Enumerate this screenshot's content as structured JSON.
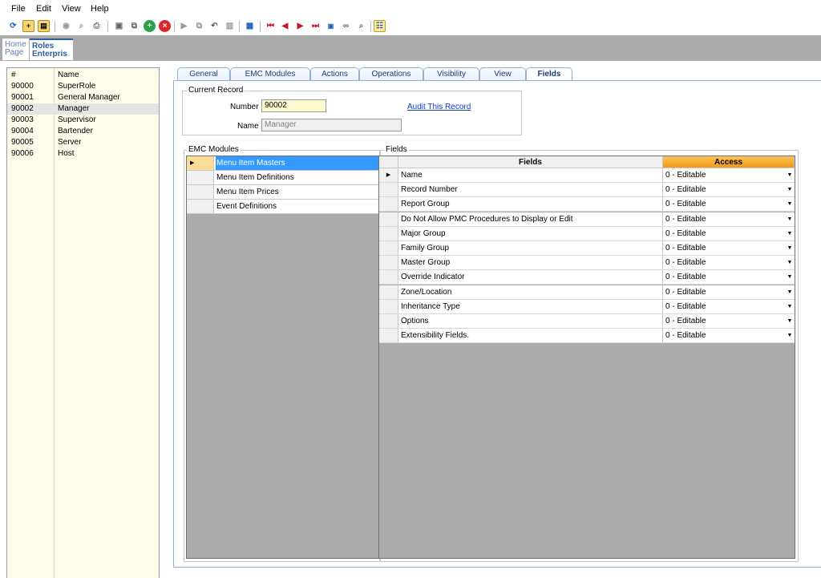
{
  "menu": [
    "File",
    "Edit",
    "View",
    "Help"
  ],
  "toolbar_icons": [
    "refresh-icon",
    "new-folder-icon",
    "open-folder-icon",
    "circle-icon",
    "search-doc-icon",
    "print-icon",
    "save-icon",
    "copy-icon",
    "add-icon",
    "delete-icon",
    "split-icon",
    "duplicate-icon",
    "undo-icon",
    "paste-icon",
    "export-icon",
    "first-record-icon",
    "previous-record-icon",
    "next-record-icon",
    "last-record-icon",
    "goto-record-icon",
    "binoculars-icon",
    "find-icon",
    "table-view-icon"
  ],
  "page_tabs": [
    {
      "line1": "Home",
      "line2": "Page"
    },
    {
      "line1": "Roles",
      "line2": "Enterpris"
    }
  ],
  "left_list": {
    "headers": [
      "#",
      "Name"
    ],
    "rows": [
      {
        "id": "90000",
        "name": "SuperRole"
      },
      {
        "id": "90001",
        "name": "General Manager"
      },
      {
        "id": "90002",
        "name": "Manager"
      },
      {
        "id": "90003",
        "name": "Supervisor"
      },
      {
        "id": "90004",
        "name": "Bartender"
      },
      {
        "id": "90005",
        "name": "Server"
      },
      {
        "id": "90006",
        "name": "Host"
      }
    ],
    "selected_index": 2
  },
  "tabs": [
    "General",
    "EMC Modules",
    "Actions",
    "Operations",
    "Visibility",
    "View",
    "Fields"
  ],
  "active_tab": "Fields",
  "current_record": {
    "legend": "Current Record",
    "number_label": "Number",
    "number_value": "90002",
    "name_label": "Name",
    "name_value": "Manager",
    "audit_link": "Audit This Record"
  },
  "emc_modules": {
    "legend": "EMC Modules",
    "rows": [
      "Menu Item Masters",
      "Menu Item Definitions",
      "Menu Item Prices",
      "Event Definitions"
    ],
    "selected_index": 0
  },
  "fields": {
    "legend": "Fields",
    "col_fields": "Fields",
    "col_access": "Access",
    "rows": [
      {
        "name": "Name",
        "access": "0 - Editable"
      },
      {
        "name": "Record Number",
        "access": "0 - Editable"
      },
      {
        "name": "Report Group",
        "access": "0 - Editable"
      },
      {
        "name": "Do Not Allow PMC Procedures to Display or Edit",
        "access": "0 - Editable"
      },
      {
        "name": "Major Group",
        "access": "0 - Editable"
      },
      {
        "name": "Family Group",
        "access": "0 - Editable"
      },
      {
        "name": "Master Group",
        "access": "0 - Editable"
      },
      {
        "name": "Override Indicator",
        "access": "0 - Editable"
      },
      {
        "name": "Zone/Location",
        "access": "0 - Editable"
      },
      {
        "name": "Inheritance Type",
        "access": "0 - Editable"
      },
      {
        "name": "Options",
        "access": "0 - Editable"
      },
      {
        "name": "Extensibility Fields.",
        "access": "0 - Editable"
      }
    ]
  },
  "colors": {
    "selected_blue": "#3399ff",
    "access_header": "#f5a623",
    "list_bg": "#fffdea",
    "link": "#0b3ccc"
  }
}
